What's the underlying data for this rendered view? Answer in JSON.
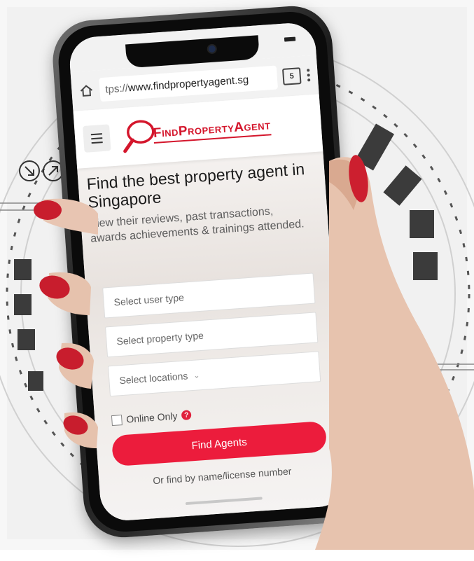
{
  "browser": {
    "url_prefix": "tps://",
    "url_domain": "www.findpropertyagent.sg",
    "tab_count": "5"
  },
  "header": {
    "logo_text": "FindPropertyAgent"
  },
  "hero": {
    "title": "Find the best property agent in Singapore",
    "subtitle": "View their reviews, past transactions, awards achievements & trainings attended."
  },
  "form": {
    "user_type_placeholder": "Select user type",
    "property_type_placeholder": "Select property type",
    "locations_placeholder": "Select locations",
    "online_only_label": "Online Only",
    "help_glyph": "?",
    "submit_label": "Find Agents",
    "alt_link": "Or find by name/license number"
  },
  "colors": {
    "brand_red": "#ec1c3c",
    "logo_red": "#d4162c"
  },
  "icons": [
    "home-icon",
    "tab-switcher-icon",
    "overflow-menu-icon",
    "hamburger-menu-icon",
    "magnifier-logo-icon",
    "chevron-down-icon",
    "help-icon"
  ]
}
